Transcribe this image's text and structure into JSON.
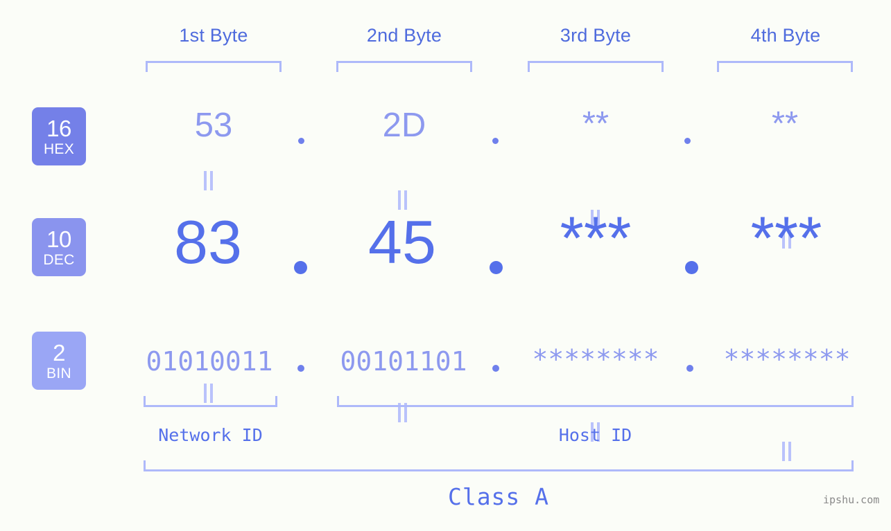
{
  "background_color": "#fbfdf8",
  "accent_colors": {
    "strong": "#5570ea",
    "medium": "#8d99ef",
    "light": "#aeb9fa",
    "badge_hex": "#7480e8",
    "badge_dec": "#8a94ee",
    "badge_bin": "#9aa6f5"
  },
  "byte_headers": [
    {
      "label": "1st Byte"
    },
    {
      "label": "2nd Byte"
    },
    {
      "label": "3rd Byte"
    },
    {
      "label": "4th Byte"
    }
  ],
  "rows": [
    {
      "badge_number": "16",
      "badge_name": "HEX",
      "values": [
        "53",
        "2D",
        "**",
        "**"
      ],
      "separator": "."
    },
    {
      "badge_number": "10",
      "badge_name": "DEC",
      "values": [
        "83",
        "45",
        "***",
        "***"
      ],
      "separator": "."
    },
    {
      "badge_number": "2",
      "badge_name": "BIN",
      "values": [
        "01010011",
        "00101101",
        "********",
        "********"
      ],
      "separator": "."
    }
  ],
  "equals_symbol": "=",
  "segments": {
    "network_id": "Network ID",
    "host_id": "Host ID"
  },
  "class_label": "Class A",
  "watermark": "ipshu.com"
}
